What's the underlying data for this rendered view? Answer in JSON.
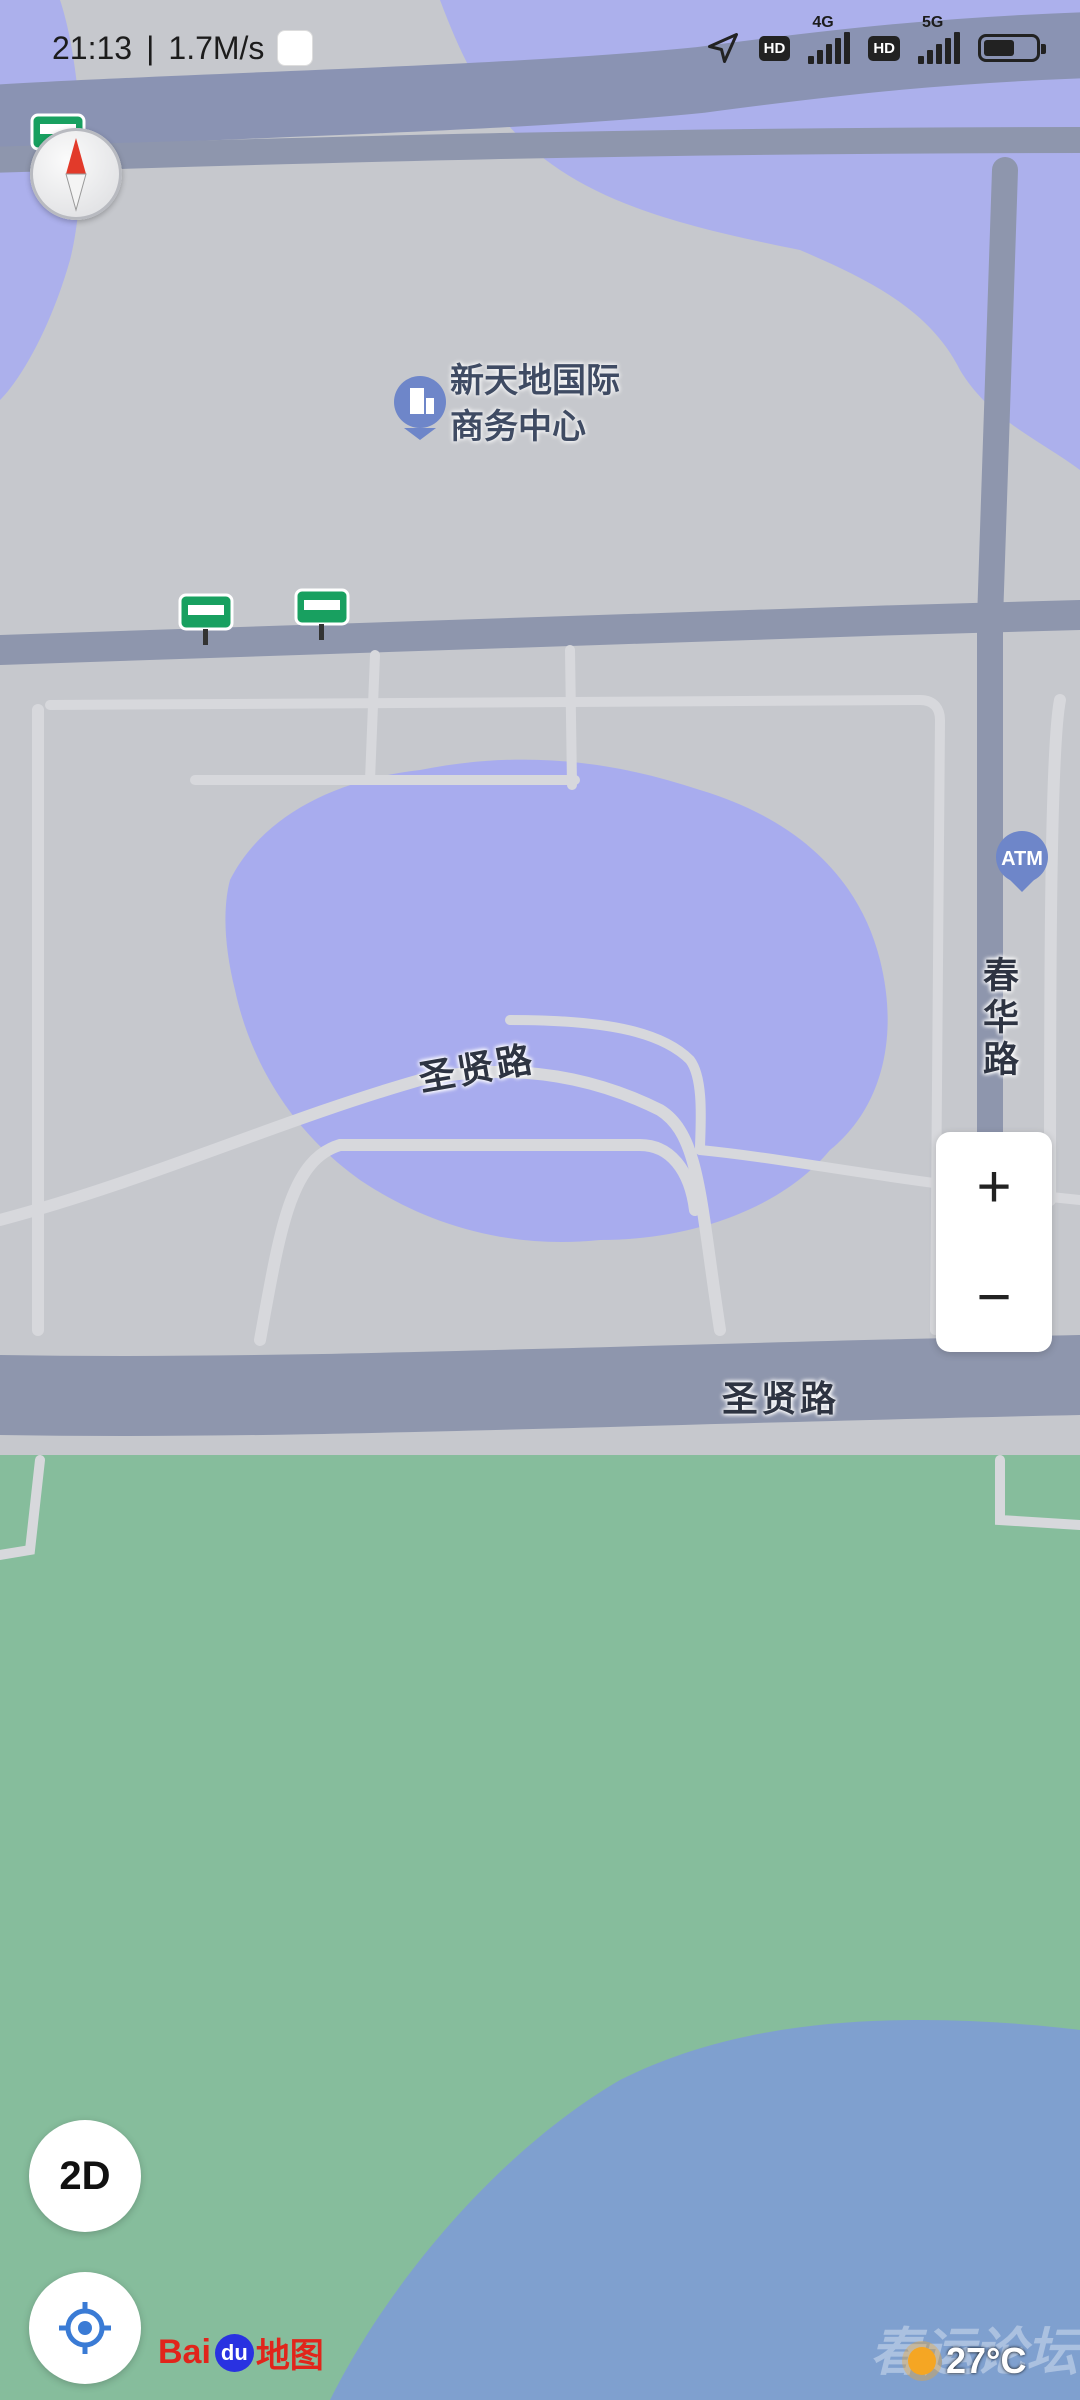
{
  "status_bar": {
    "time": "21:13",
    "network_speed": "1.7M/s",
    "hd_badge": "HD",
    "net1": "4G",
    "net2": "5G"
  },
  "map": {
    "poi_business_center": "新天地国际商务中心",
    "poi_business_center_line1": "新天地国际",
    "poi_business_center_line2": "商务中心",
    "road_shengxian_upper": "圣贤路",
    "road_shengxian_lower": "圣贤路",
    "road_chunhua": "春华路",
    "atm_label": "ATM"
  },
  "controls": {
    "zoom_in": "+",
    "zoom_out": "−",
    "view_mode": "2D"
  },
  "branding": {
    "logo_bai": "Bai",
    "logo_du": "du",
    "logo_map": "地图",
    "watermark": "春运论坛"
  },
  "weather": {
    "temperature": "27°C"
  },
  "colors": {
    "land": "#c6c8cd",
    "road": "#8e96ad",
    "road_light": "#d7d8dc",
    "heat_purple": "#a7abef",
    "park_green": "#86bd9c",
    "water": "#7fa0cf",
    "accent_blue": "#3a7bd5"
  }
}
